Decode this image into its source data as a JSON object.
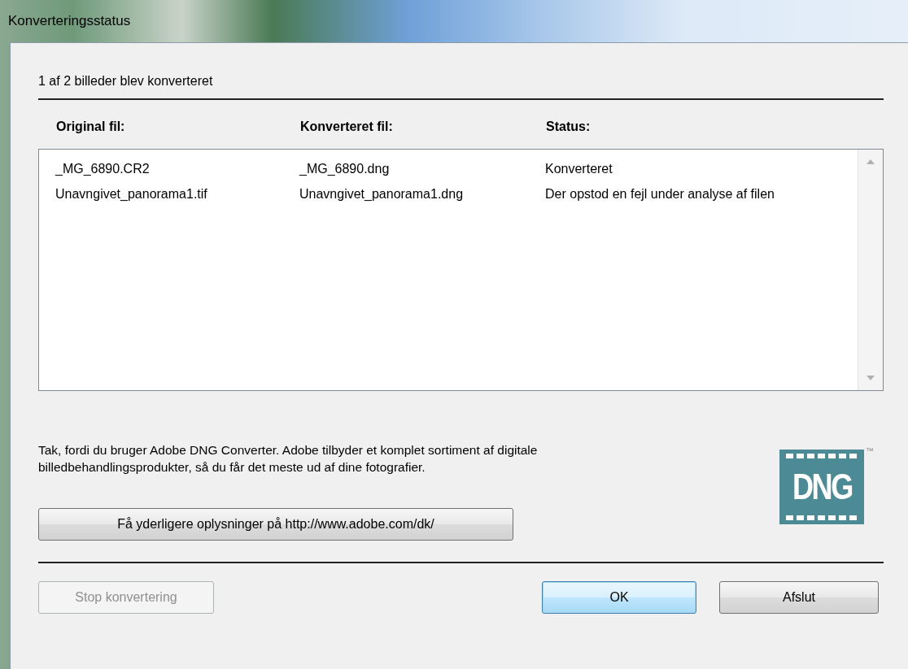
{
  "window": {
    "title": "Konverteringsstatus"
  },
  "summary": "1 af 2 billeder blev konverteret",
  "table": {
    "columns": [
      "Original fil:",
      "Konverteret fil:",
      "Status:"
    ],
    "rows": [
      [
        "_MG_6890.CR2",
        "_MG_6890.dng",
        "Konverteret"
      ],
      [
        "Unavngivet_panorama1.tif",
        "Unavngivet_panorama1.dng",
        "Der opstod en fejl under analyse af filen"
      ]
    ]
  },
  "message": "Tak, fordi du bruger Adobe DNG Converter. Adobe tilbyder et komplet sortiment af digitale billedbehandlingsprodukter, så du får det meste ud af dine fotografier.",
  "logo": {
    "text": "DNG",
    "mark": "™"
  },
  "link_button": {
    "label": "Få yderligere oplysninger på http://www.adobe.com/dk/",
    "disabled": false,
    "default": false
  },
  "buttons": [
    {
      "label": "Stop konvertering",
      "disabled": true,
      "default": false
    },
    {
      "label": "OK",
      "disabled": false,
      "default": true
    },
    {
      "label": "Afslut",
      "disabled": false,
      "default": false
    }
  ]
}
